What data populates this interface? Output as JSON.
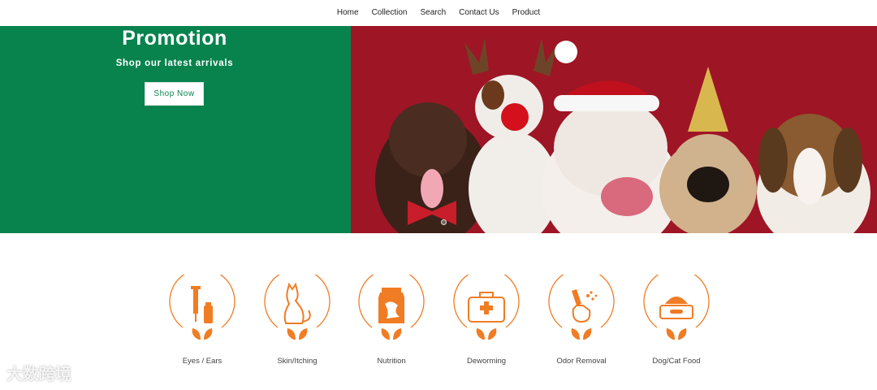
{
  "nav": {
    "items": [
      "Home",
      "Collection",
      "Search",
      "Contact Us",
      "Product"
    ]
  },
  "hero": {
    "title": "Promotion",
    "subtitle": "Shop our latest arrivals",
    "button": "Shop Now",
    "left_color": "#08834e",
    "right_color": "#9e1525",
    "image_description": "dogs-in-christmas-costumes-photo"
  },
  "categories": [
    {
      "label": "Eyes / Ears",
      "icon": "syringe-medicine-icon"
    },
    {
      "label": "Skin/Itching",
      "icon": "cat-icon"
    },
    {
      "label": "Nutrition",
      "icon": "milk-carton-icon"
    },
    {
      "label": "Deworming",
      "icon": "first-aid-kit-icon"
    },
    {
      "label": "Odor Removal",
      "icon": "spray-bottle-icon"
    },
    {
      "label": "Dog/Cat Food",
      "icon": "food-bowl-icon"
    }
  ],
  "accent_color": "#f07c24",
  "watermark": "大数跨境"
}
